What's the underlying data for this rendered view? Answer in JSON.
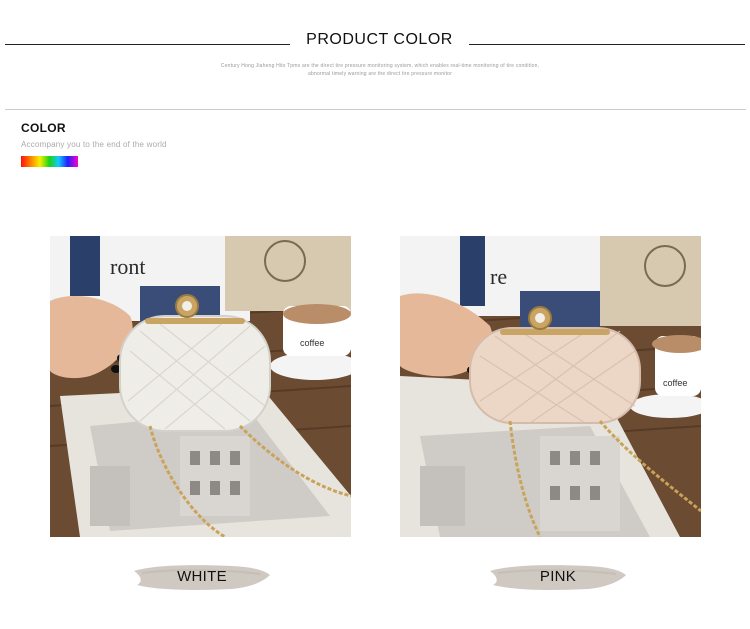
{
  "header": {
    "title": "PRODUCT COLOR",
    "subtitle_line1": "Century Hong Jiaheng Hits Tpms are the direct tire pressure monitoring system, which enables real-time monitoring of tire condition,",
    "subtitle_line2": "abnormal timely warning are the direct tire pressure monitor"
  },
  "color_section": {
    "title": "COLOR",
    "tagline": "Accompany you to the end of the world"
  },
  "variants": [
    {
      "label": "WHITE",
      "image": "white-clutch-photo",
      "bag_color": "#efede8"
    },
    {
      "label": "PINK",
      "image": "pink-clutch-photo",
      "bag_color": "#ecd6c6"
    }
  ]
}
